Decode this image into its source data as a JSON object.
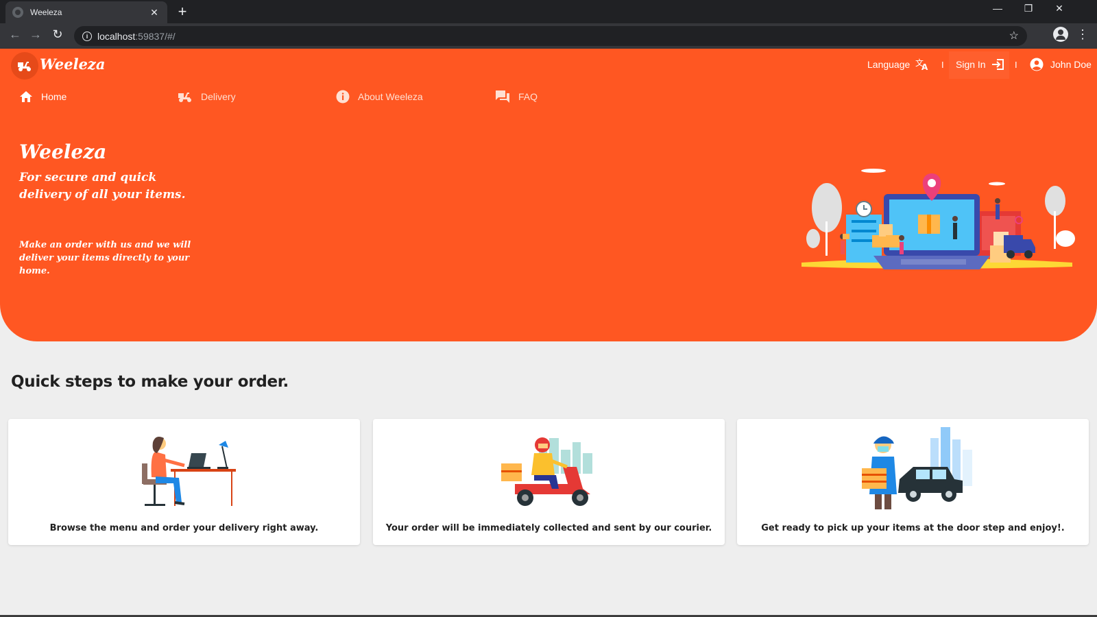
{
  "browser": {
    "tab_title": "Weeleza",
    "tab_close": "✕",
    "new_tab": "+",
    "url_host": "localhost",
    "url_rest": ":59837/#/",
    "window_controls": {
      "minimize": "—",
      "restore": "❐",
      "close": "✕"
    }
  },
  "header": {
    "brand": "Weeleza",
    "language_label": "Language",
    "signin_label": "Sign In",
    "user_name": "John Doe",
    "separator": "I"
  },
  "nav": {
    "tabs": [
      {
        "label": "Home",
        "icon": "home-icon",
        "active": true
      },
      {
        "label": "Delivery",
        "icon": "scooter-icon",
        "active": false
      },
      {
        "label": "About Weeleza",
        "icon": "info-icon",
        "active": false
      },
      {
        "label": "FAQ",
        "icon": "forum-icon",
        "active": false
      }
    ]
  },
  "hero": {
    "title": "Weeleza",
    "subtitle": "For secure and quick delivery of all your items.",
    "text": "Make an order with us and we will deliver your items directly to your home."
  },
  "steps": {
    "title": "Quick steps to make your order.",
    "cards": [
      {
        "caption": "Browse the menu and order your delivery right away.",
        "illustration": "woman-at-desk-illustration"
      },
      {
        "caption": "Your order will be immediately collected and sent by our courier.",
        "illustration": "courier-scooter-illustration"
      },
      {
        "caption": "Get ready to pick up your items at the door step and enjoy!.",
        "illustration": "delivery-man-car-illustration"
      }
    ]
  },
  "colors": {
    "primary": "#ff5722",
    "primary_dark": "#e64a19",
    "background": "#eeeeee"
  }
}
